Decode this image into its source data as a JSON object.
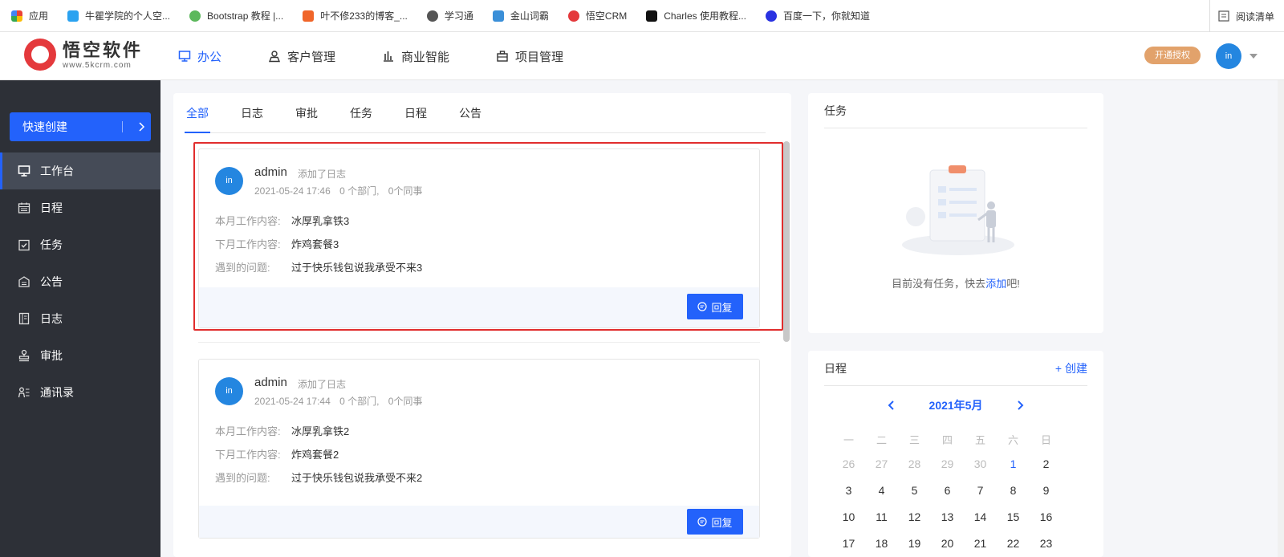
{
  "bookmarks": [
    {
      "label": "应用",
      "color": "#4285f4"
    },
    {
      "label": "牛瞿学院的个人空...",
      "color": "#2aa2f0"
    },
    {
      "label": "Bootstrap 教程 |...",
      "color": "#5cb85c"
    },
    {
      "label": "叶不修233的博客_...",
      "color": "#f06529"
    },
    {
      "label": "学习通",
      "color": "#555555"
    },
    {
      "label": "金山词霸",
      "color": "#3a8fd8"
    },
    {
      "label": "悟空CRM",
      "color": "#e4393c"
    },
    {
      "label": "Charles 使用教程...",
      "color": "#111111"
    },
    {
      "label": "百度一下，你就知道",
      "color": "#2932e1"
    }
  ],
  "bookmarks_right": "阅读清单",
  "header": {
    "logo_title": "悟空软件",
    "logo_url": "www.5kcrm.com",
    "nav": [
      {
        "label": "办公",
        "icon": "desktop-icon",
        "active": true
      },
      {
        "label": "客户管理",
        "icon": "user-icon",
        "active": false
      },
      {
        "label": "商业智能",
        "icon": "bar-chart-icon",
        "active": false
      },
      {
        "label": "项目管理",
        "icon": "briefcase-icon",
        "active": false
      }
    ],
    "upgrade": "开通授权",
    "avatar": "in"
  },
  "sidebar": {
    "quick_create": "快速创建",
    "items": [
      {
        "label": "工作台",
        "icon": "desktop-icon",
        "active": true
      },
      {
        "label": "日程",
        "icon": "calendar-icon",
        "active": false
      },
      {
        "label": "任务",
        "icon": "task-check-icon",
        "active": false
      },
      {
        "label": "公告",
        "icon": "announcement-icon",
        "active": false
      },
      {
        "label": "日志",
        "icon": "log-book-icon",
        "active": false
      },
      {
        "label": "审批",
        "icon": "stamp-icon",
        "active": false
      },
      {
        "label": "通讯录",
        "icon": "contacts-icon",
        "active": false
      }
    ]
  },
  "feed": {
    "tabs": [
      "全部",
      "日志",
      "审批",
      "任务",
      "日程",
      "公告"
    ],
    "active_tab": "全部",
    "cards": [
      {
        "avatar": "in",
        "user": "admin",
        "action": "添加了日志",
        "time": "2021-05-24 17:46",
        "depts": "0 个部门,",
        "colleagues": "0个同事",
        "fields": [
          {
            "label": "本月工作内容:",
            "value": "冰厚乳拿铁3"
          },
          {
            "label": "下月工作内容:",
            "value": "炸鸡套餐3"
          },
          {
            "label": "遇到的问题:",
            "value": "过于快乐钱包说我承受不来3"
          }
        ],
        "reply": "回复"
      },
      {
        "avatar": "in",
        "user": "admin",
        "action": "添加了日志",
        "time": "2021-05-24 17:44",
        "depts": "0 个部门,",
        "colleagues": "0个同事",
        "fields": [
          {
            "label": "本月工作内容:",
            "value": "冰厚乳拿铁2"
          },
          {
            "label": "下月工作内容:",
            "value": "炸鸡套餐2"
          },
          {
            "label": "遇到的问题:",
            "value": "过于快乐钱包说我承受不来2"
          }
        ],
        "reply": "回复"
      }
    ]
  },
  "task_panel": {
    "title": "任务",
    "empty_prefix": "目前没有任务，快去",
    "empty_link": "添加",
    "empty_suffix": "吧!"
  },
  "calendar": {
    "title": "日程",
    "create": "+ 创建",
    "month": "2021年5月",
    "weekdays": [
      "一",
      "二",
      "三",
      "四",
      "五",
      "六",
      "日"
    ],
    "weeks": [
      [
        "26",
        "27",
        "28",
        "29",
        "30",
        "1",
        "2"
      ],
      [
        "3",
        "4",
        "5",
        "6",
        "7",
        "8",
        "9"
      ],
      [
        "10",
        "11",
        "12",
        "13",
        "14",
        "15",
        "16"
      ],
      [
        "17",
        "18",
        "19",
        "20",
        "21",
        "22",
        "23"
      ]
    ],
    "prev_month_days": [
      "26",
      "27",
      "28",
      "29",
      "30"
    ],
    "today": "1"
  },
  "colors": {
    "accent": "#2362fb",
    "sidebar_bg": "#2d3037",
    "highlight": "#e12d2d",
    "upgrade": "#e2a26b"
  }
}
